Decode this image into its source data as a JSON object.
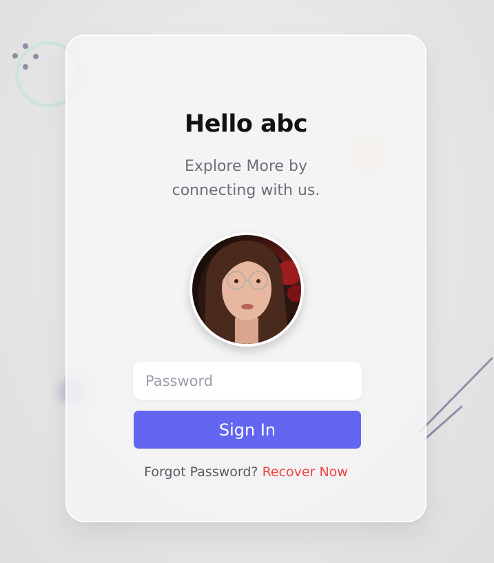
{
  "card": {
    "title": "Hello abc",
    "subtitle_line1": "Explore More by",
    "subtitle_line2": "connecting with us."
  },
  "avatar": {
    "icon": "user-photo-avatar"
  },
  "form": {
    "password_placeholder": "Password",
    "signin_label": "Sign In",
    "forgot_text": "Forgot Password?",
    "recover_link": "Recover Now"
  },
  "colors": {
    "accent": "#6366f1",
    "link": "#ef4444",
    "background": "#e6e6e6",
    "card": "#f5f5f6"
  }
}
